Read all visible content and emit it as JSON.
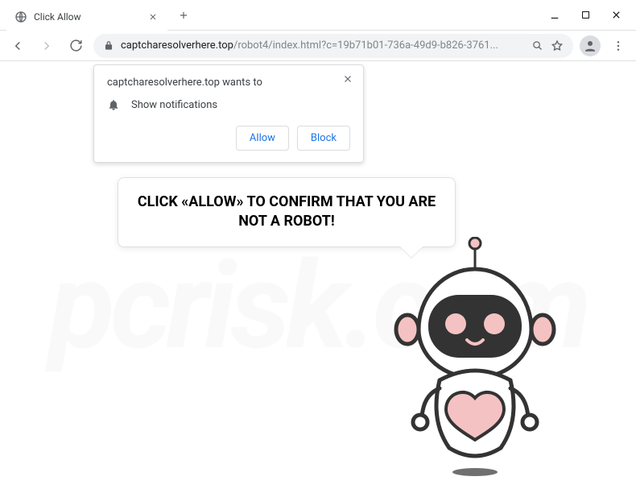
{
  "window": {
    "tab_title": "Click Allow"
  },
  "address": {
    "domain": "captcharesolverhere.top",
    "path": "/robot4/index.html?c=19b71b01-736a-49d9-b826-3761..."
  },
  "prompt": {
    "title": "captcharesolverhere.top wants to",
    "permission_text": "Show notifications",
    "allow_label": "Allow",
    "block_label": "Block"
  },
  "page": {
    "bubble_text": "CLICK «ALLOW» TO CONFIRM THAT YOU ARE NOT A ROBOT!"
  },
  "watermark": "pcrisk.com"
}
